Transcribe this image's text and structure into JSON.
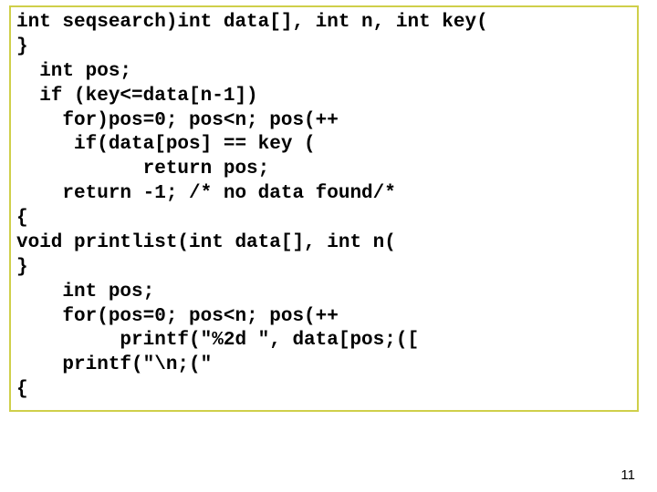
{
  "slide_number": "11",
  "code": {
    "l1": "int seqsearch)int data[], int n, int key(",
    "l2": "}",
    "l3": "  int pos;",
    "l4": "  if (key<=data[n-1])",
    "l5": "    for)pos=0; pos<n; pos(++",
    "l6": "     if(data[pos] == key (",
    "l7": "           return pos;",
    "l8": "    return -1; /* no data found/*",
    "l9": "{",
    "l10": "void printlist(int data[], int n(",
    "l11": "}",
    "l12": "    int pos;",
    "l13": "    for(pos=0; pos<n; pos(++",
    "l14": "         printf(\"%2d \", data[pos;([",
    "l15": "    printf(\"\\n;(\"",
    "l16": "{"
  }
}
